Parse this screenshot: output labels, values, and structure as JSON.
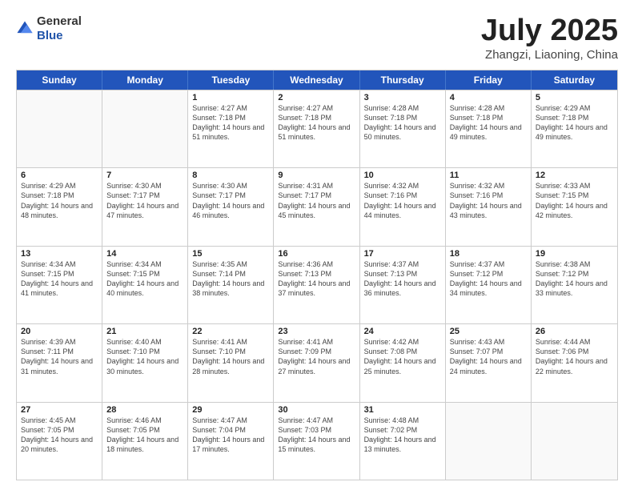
{
  "header": {
    "logo_general": "General",
    "logo_blue": "Blue",
    "title": "July 2025",
    "location": "Zhangzi, Liaoning, China"
  },
  "calendar": {
    "days_of_week": [
      "Sunday",
      "Monday",
      "Tuesday",
      "Wednesday",
      "Thursday",
      "Friday",
      "Saturday"
    ],
    "weeks": [
      [
        {
          "day": "",
          "empty": true
        },
        {
          "day": "",
          "empty": true
        },
        {
          "day": "1",
          "sunrise": "4:27 AM",
          "sunset": "7:18 PM",
          "daylight": "14 hours and 51 minutes."
        },
        {
          "day": "2",
          "sunrise": "4:27 AM",
          "sunset": "7:18 PM",
          "daylight": "14 hours and 51 minutes."
        },
        {
          "day": "3",
          "sunrise": "4:28 AM",
          "sunset": "7:18 PM",
          "daylight": "14 hours and 50 minutes."
        },
        {
          "day": "4",
          "sunrise": "4:28 AM",
          "sunset": "7:18 PM",
          "daylight": "14 hours and 49 minutes."
        },
        {
          "day": "5",
          "sunrise": "4:29 AM",
          "sunset": "7:18 PM",
          "daylight": "14 hours and 49 minutes."
        }
      ],
      [
        {
          "day": "6",
          "sunrise": "4:29 AM",
          "sunset": "7:18 PM",
          "daylight": "14 hours and 48 minutes."
        },
        {
          "day": "7",
          "sunrise": "4:30 AM",
          "sunset": "7:17 PM",
          "daylight": "14 hours and 47 minutes."
        },
        {
          "day": "8",
          "sunrise": "4:30 AM",
          "sunset": "7:17 PM",
          "daylight": "14 hours and 46 minutes."
        },
        {
          "day": "9",
          "sunrise": "4:31 AM",
          "sunset": "7:17 PM",
          "daylight": "14 hours and 45 minutes."
        },
        {
          "day": "10",
          "sunrise": "4:32 AM",
          "sunset": "7:16 PM",
          "daylight": "14 hours and 44 minutes."
        },
        {
          "day": "11",
          "sunrise": "4:32 AM",
          "sunset": "7:16 PM",
          "daylight": "14 hours and 43 minutes."
        },
        {
          "day": "12",
          "sunrise": "4:33 AM",
          "sunset": "7:15 PM",
          "daylight": "14 hours and 42 minutes."
        }
      ],
      [
        {
          "day": "13",
          "sunrise": "4:34 AM",
          "sunset": "7:15 PM",
          "daylight": "14 hours and 41 minutes."
        },
        {
          "day": "14",
          "sunrise": "4:34 AM",
          "sunset": "7:15 PM",
          "daylight": "14 hours and 40 minutes."
        },
        {
          "day": "15",
          "sunrise": "4:35 AM",
          "sunset": "7:14 PM",
          "daylight": "14 hours and 38 minutes."
        },
        {
          "day": "16",
          "sunrise": "4:36 AM",
          "sunset": "7:13 PM",
          "daylight": "14 hours and 37 minutes."
        },
        {
          "day": "17",
          "sunrise": "4:37 AM",
          "sunset": "7:13 PM",
          "daylight": "14 hours and 36 minutes."
        },
        {
          "day": "18",
          "sunrise": "4:37 AM",
          "sunset": "7:12 PM",
          "daylight": "14 hours and 34 minutes."
        },
        {
          "day": "19",
          "sunrise": "4:38 AM",
          "sunset": "7:12 PM",
          "daylight": "14 hours and 33 minutes."
        }
      ],
      [
        {
          "day": "20",
          "sunrise": "4:39 AM",
          "sunset": "7:11 PM",
          "daylight": "14 hours and 31 minutes."
        },
        {
          "day": "21",
          "sunrise": "4:40 AM",
          "sunset": "7:10 PM",
          "daylight": "14 hours and 30 minutes."
        },
        {
          "day": "22",
          "sunrise": "4:41 AM",
          "sunset": "7:10 PM",
          "daylight": "14 hours and 28 minutes."
        },
        {
          "day": "23",
          "sunrise": "4:41 AM",
          "sunset": "7:09 PM",
          "daylight": "14 hours and 27 minutes."
        },
        {
          "day": "24",
          "sunrise": "4:42 AM",
          "sunset": "7:08 PM",
          "daylight": "14 hours and 25 minutes."
        },
        {
          "day": "25",
          "sunrise": "4:43 AM",
          "sunset": "7:07 PM",
          "daylight": "14 hours and 24 minutes."
        },
        {
          "day": "26",
          "sunrise": "4:44 AM",
          "sunset": "7:06 PM",
          "daylight": "14 hours and 22 minutes."
        }
      ],
      [
        {
          "day": "27",
          "sunrise": "4:45 AM",
          "sunset": "7:05 PM",
          "daylight": "14 hours and 20 minutes."
        },
        {
          "day": "28",
          "sunrise": "4:46 AM",
          "sunset": "7:05 PM",
          "daylight": "14 hours and 18 minutes."
        },
        {
          "day": "29",
          "sunrise": "4:47 AM",
          "sunset": "7:04 PM",
          "daylight": "14 hours and 17 minutes."
        },
        {
          "day": "30",
          "sunrise": "4:47 AM",
          "sunset": "7:03 PM",
          "daylight": "14 hours and 15 minutes."
        },
        {
          "day": "31",
          "sunrise": "4:48 AM",
          "sunset": "7:02 PM",
          "daylight": "14 hours and 13 minutes."
        },
        {
          "day": "",
          "empty": true
        },
        {
          "day": "",
          "empty": true
        }
      ]
    ]
  }
}
